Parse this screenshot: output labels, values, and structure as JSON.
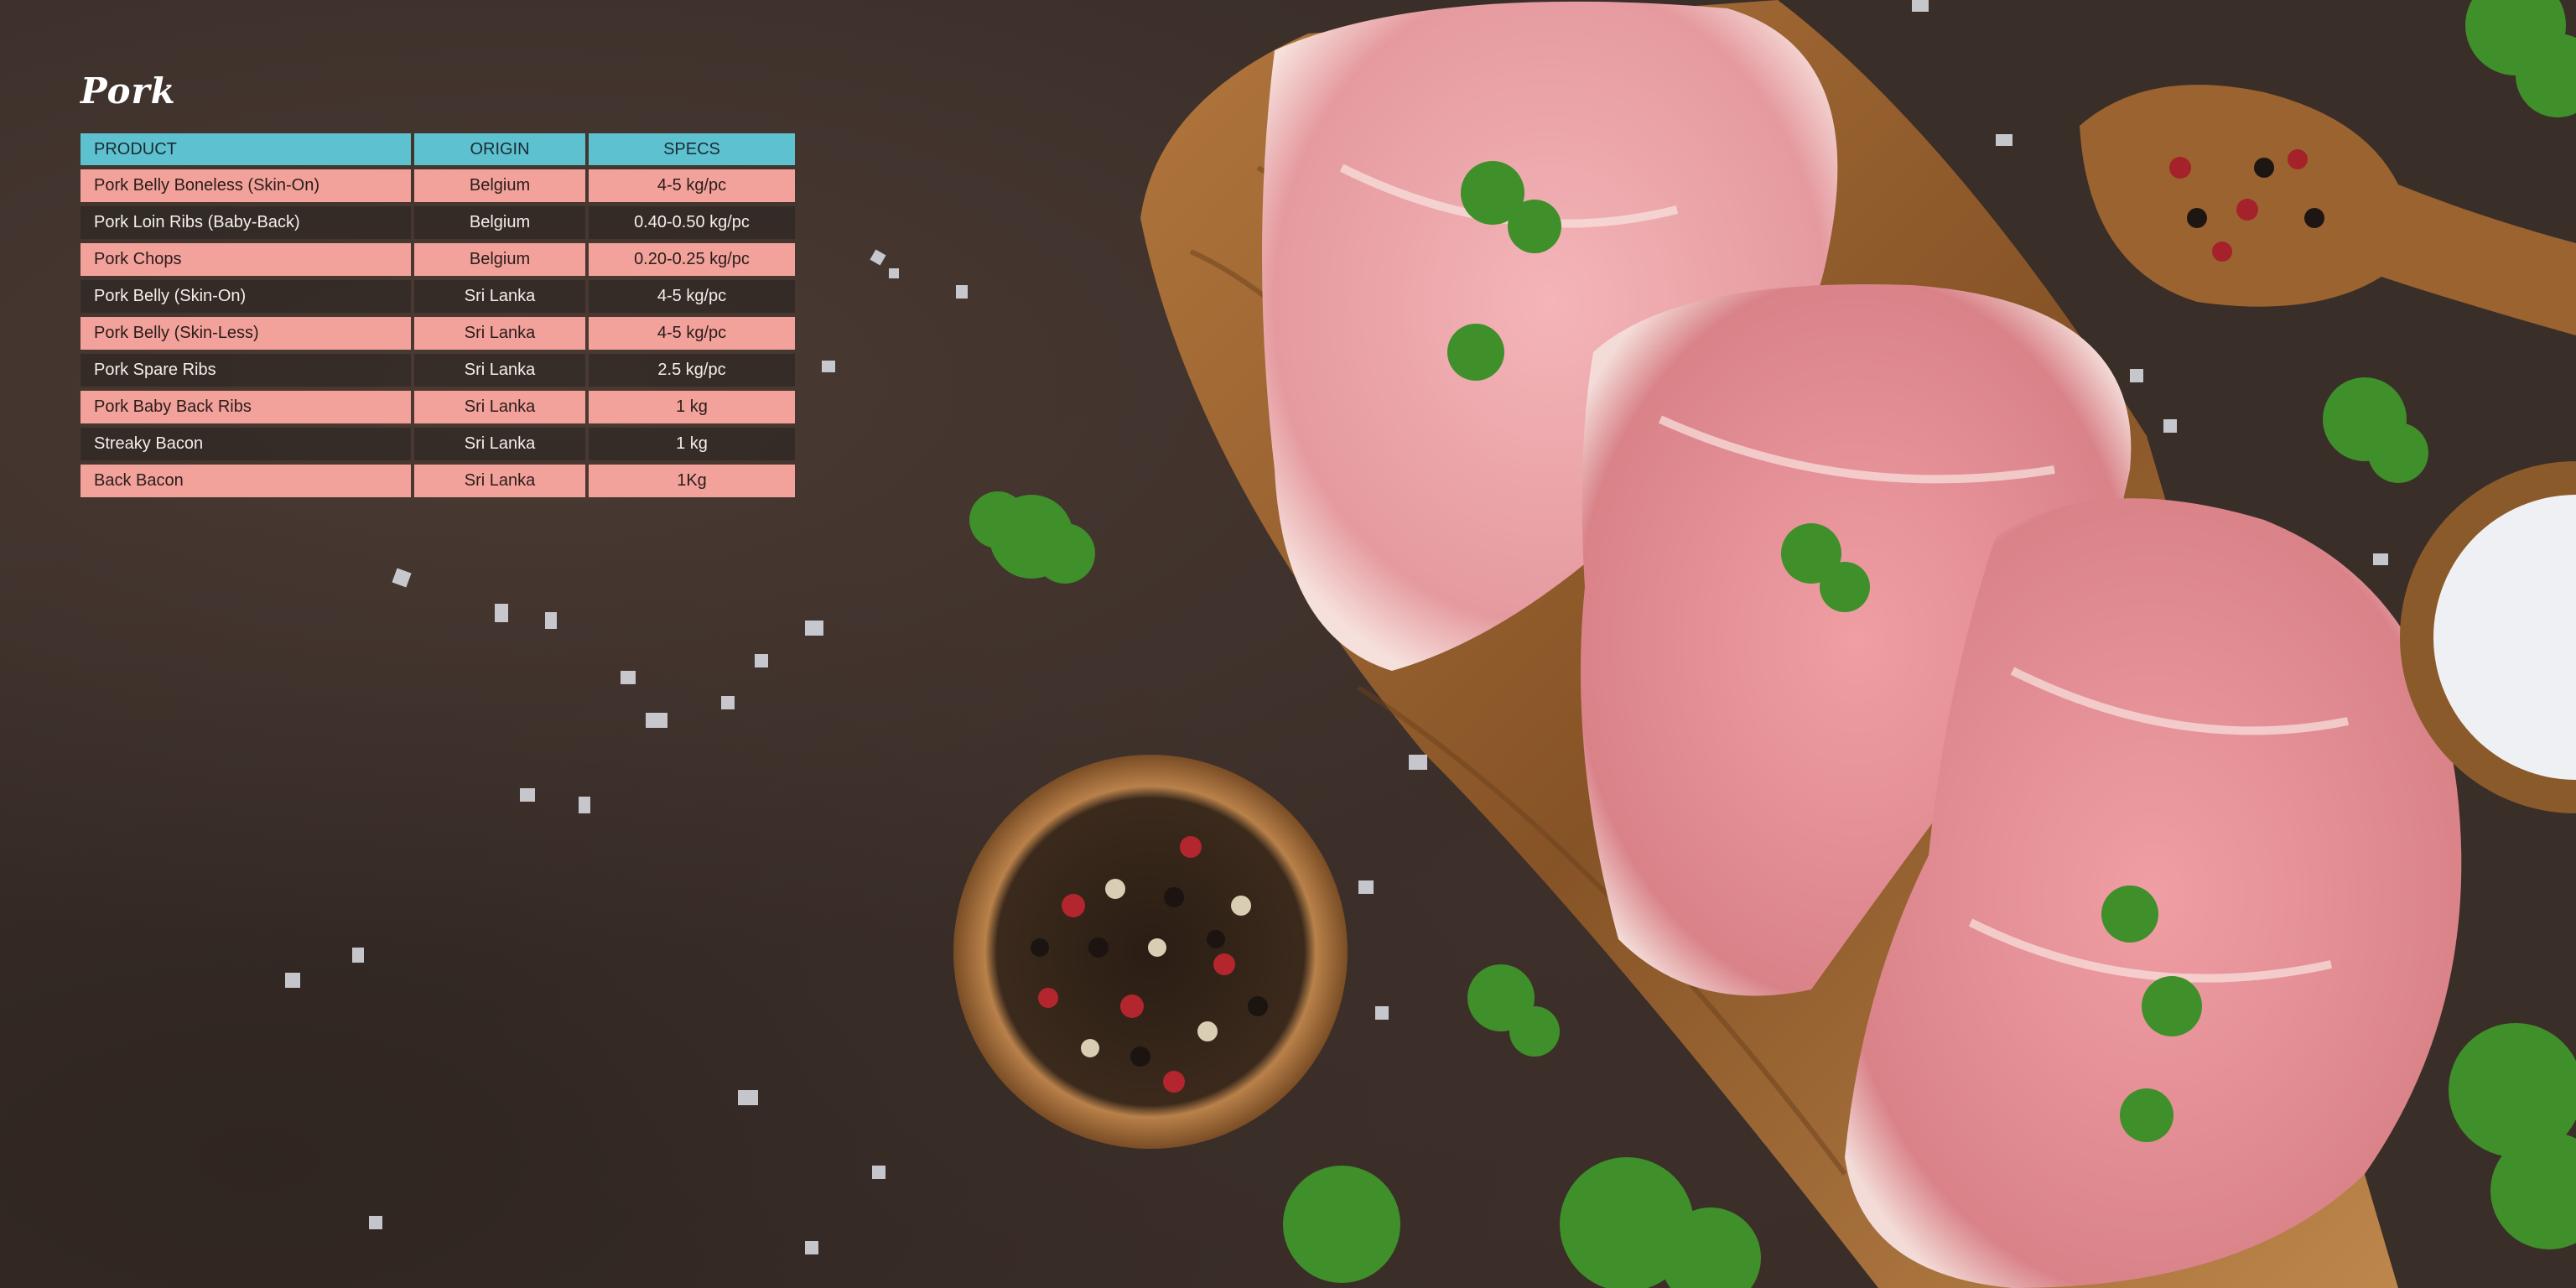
{
  "title": "Pork",
  "table": {
    "headers": [
      "PRODUCT",
      "ORIGIN",
      "SPECS"
    ],
    "rows": [
      {
        "product": "Pork Belly Boneless (Skin-On)",
        "origin": "Belgium",
        "specs": "4-5 kg/pc"
      },
      {
        "product": "Pork Loin Ribs (Baby-Back)",
        "origin": "Belgium",
        "specs": "0.40-0.50 kg/pc"
      },
      {
        "product": "Pork Chops",
        "origin": "Belgium",
        "specs": "0.20-0.25 kg/pc"
      },
      {
        "product": "Pork Belly (Skin-On)",
        "origin": "Sri Lanka",
        "specs": "4-5 kg/pc"
      },
      {
        "product": "Pork Belly (Skin-Less)",
        "origin": "Sri Lanka",
        "specs": "4-5 kg/pc"
      },
      {
        "product": "Pork Spare Ribs",
        "origin": "Sri Lanka",
        "specs": "2.5 kg/pc"
      },
      {
        "product": "Pork Baby Back Ribs",
        "origin": "Sri Lanka",
        "specs": "1 kg"
      },
      {
        "product": "Streaky Bacon",
        "origin": "Sri Lanka",
        "specs": "1 kg"
      },
      {
        "product": "Back Bacon",
        "origin": "Sri Lanka",
        "specs": "1Kg"
      }
    ]
  },
  "colors": {
    "header": "#5ec1cf",
    "row_pink": "#f2a29b",
    "row_dark": "#2b2522",
    "background": "#3a2e29"
  }
}
